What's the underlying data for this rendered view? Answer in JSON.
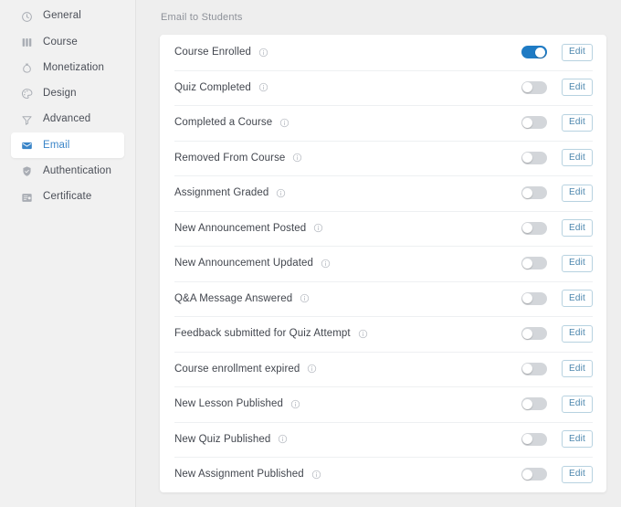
{
  "sidebar": {
    "items": [
      {
        "label": "General",
        "icon": "clock-icon",
        "active": false
      },
      {
        "label": "Course",
        "icon": "book-icon",
        "active": false
      },
      {
        "label": "Monetization",
        "icon": "money-bag-icon",
        "active": false
      },
      {
        "label": "Design",
        "icon": "palette-icon",
        "active": false
      },
      {
        "label": "Advanced",
        "icon": "funnel-icon",
        "active": false
      },
      {
        "label": "Email",
        "icon": "envelope-icon",
        "active": true
      },
      {
        "label": "Authentication",
        "icon": "shield-icon",
        "active": false
      },
      {
        "label": "Certificate",
        "icon": "certificate-icon",
        "active": false
      }
    ]
  },
  "main": {
    "section_title": "Email to Students",
    "edit_label": "Edit",
    "info_icon": "info-circle-icon",
    "rows": [
      {
        "label": "Course Enrolled",
        "enabled": true
      },
      {
        "label": "Quiz Completed",
        "enabled": false
      },
      {
        "label": "Completed a Course",
        "enabled": false
      },
      {
        "label": "Removed From Course",
        "enabled": false
      },
      {
        "label": "Assignment Graded",
        "enabled": false
      },
      {
        "label": "New Announcement Posted",
        "enabled": false
      },
      {
        "label": "New Announcement Updated",
        "enabled": false
      },
      {
        "label": "Q&A Message Answered",
        "enabled": false
      },
      {
        "label": "Feedback submitted for Quiz Attempt",
        "enabled": false
      },
      {
        "label": "Course enrollment expired",
        "enabled": false
      },
      {
        "label": "New Lesson Published",
        "enabled": false
      },
      {
        "label": "New Quiz Published",
        "enabled": false
      },
      {
        "label": "New Assignment Published",
        "enabled": false
      }
    ]
  },
  "colors": {
    "accent": "#1f7bc4",
    "active_nav_text": "#3a85c8",
    "edit_border": "#b7d2e0",
    "edit_text": "#4b86ad",
    "toggle_off": "#d3d6da",
    "page_bg": "#eeeeee",
    "sidebar_bg": "#f1f1f1",
    "card_bg": "#ffffff",
    "label_text": "#42464e",
    "muted_text": "#8d9199"
  }
}
